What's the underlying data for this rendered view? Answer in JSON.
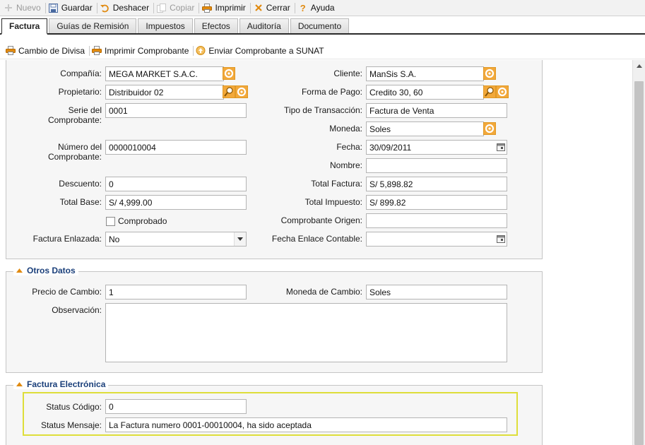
{
  "toolbar": {
    "items": [
      {
        "label": "Nuevo",
        "icon": "plus-icon"
      },
      {
        "label": "Guardar",
        "icon": "save-icon"
      },
      {
        "label": "Deshacer",
        "icon": "undo-icon"
      },
      {
        "label": "Copiar",
        "icon": "copy-icon"
      },
      {
        "label": "Imprimir",
        "icon": "print-icon"
      },
      {
        "label": "Cerrar",
        "icon": "close-icon"
      },
      {
        "label": "Ayuda",
        "icon": "help-icon"
      }
    ]
  },
  "tabs": [
    "Factura",
    "Guías de Remisión",
    "Impuestos",
    "Efectos",
    "Auditoría",
    "Documento"
  ],
  "subbar": {
    "cambio_divisa": "Cambio de Divisa",
    "imprimir_comprobante": "Imprimir Comprobante",
    "enviar_sunat": "Enviar Comprobante a SUNAT"
  },
  "form": {
    "compania": {
      "label": "Compañía:",
      "value": "MEGA MARKET S.A.C."
    },
    "propietario": {
      "label": "Propietario:",
      "value": "Distribuidor 02"
    },
    "serie": {
      "label1": "Serie del",
      "label2": "Comprobante:",
      "value": "0001"
    },
    "numero": {
      "label1": "Número del",
      "label2": "Comprobante:",
      "value": "0000010004"
    },
    "descuento": {
      "label": "Descuento:",
      "value": "0"
    },
    "total_base": {
      "label": "Total Base:",
      "value": "S/ 4,999.00"
    },
    "comprobado": {
      "label": "Comprobado",
      "checked": false
    },
    "factura_enlazada": {
      "label": "Factura Enlazada:",
      "value": "No"
    },
    "cliente": {
      "label": "Cliente:",
      "value": "ManSis S.A."
    },
    "forma_pago": {
      "label": "Forma de Pago:",
      "value": "Credito 30, 60"
    },
    "tipo_transaccion": {
      "label": "Tipo de Transacción:",
      "value": "Factura de Venta"
    },
    "moneda": {
      "label": "Moneda:",
      "value": "Soles"
    },
    "fecha": {
      "label": "Fecha:",
      "value": "30/09/2011"
    },
    "nombre": {
      "label": "Nombre:",
      "value": ""
    },
    "total_factura": {
      "label": "Total Factura:",
      "value": "S/ 5,898.82"
    },
    "total_impuesto": {
      "label": "Total Impuesto:",
      "value": "S/ 899.82"
    },
    "comprobante_origen": {
      "label": "Comprobante Origen:",
      "value": ""
    },
    "fecha_enlace": {
      "label": "Fecha Enlace Contable:",
      "value": ""
    }
  },
  "otros_datos": {
    "title": "Otros Datos",
    "precio_cambio": {
      "label": "Precio de Cambio:",
      "value": "1"
    },
    "moneda_cambio": {
      "label": "Moneda de Cambio:",
      "value": "Soles"
    },
    "observacion": {
      "label": "Observación:",
      "value": ""
    }
  },
  "factura_electronica": {
    "title": "Factura Electrónica",
    "status_codigo": {
      "label": "Status Código:",
      "value": "0"
    },
    "status_mensaje": {
      "label": "Status Mensaje:",
      "value": "La Factura numero 0001-00010004, ha sido aceptada"
    }
  },
  "colors": {
    "accent_orange": "#f0a020",
    "legend_blue": "#1a3f7a",
    "highlight": "#dede3a"
  }
}
